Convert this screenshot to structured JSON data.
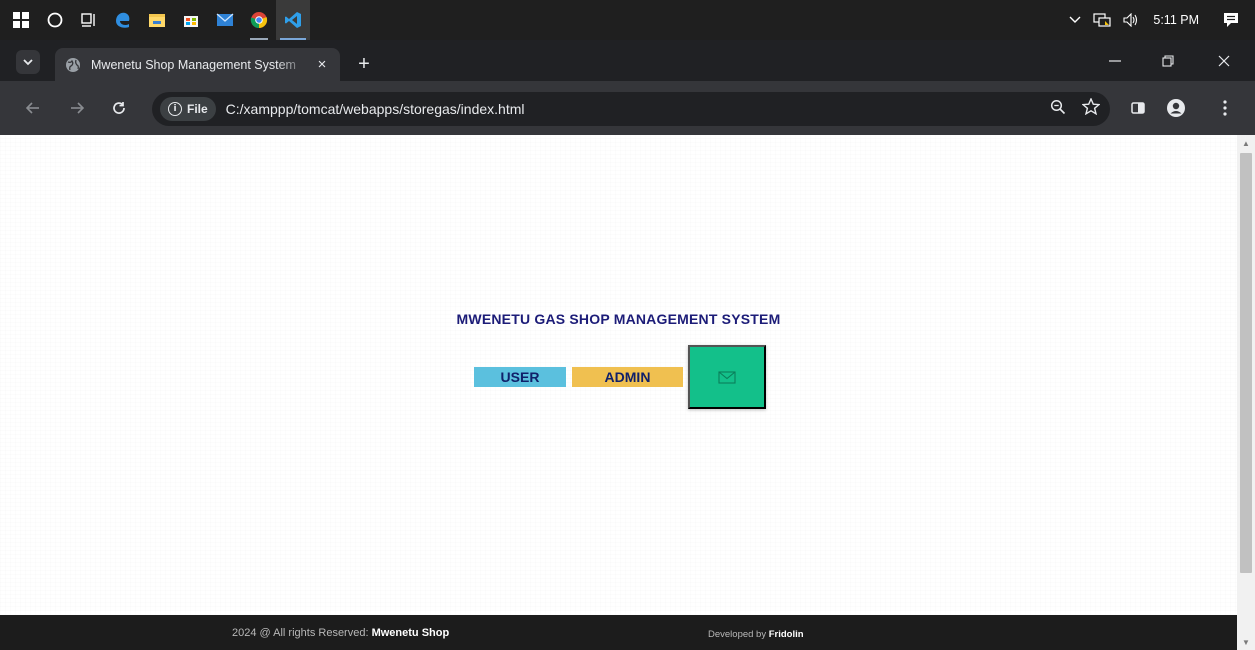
{
  "taskbar": {
    "icons": [
      "windows-start-icon",
      "cortana-search-icon",
      "task-view-icon",
      "edge-icon",
      "file-explorer-icon",
      "store-icon",
      "mail-icon",
      "chrome-icon",
      "vscode-icon"
    ],
    "tray": {
      "time": "5:11 PM"
    }
  },
  "browser": {
    "tab_title": "Mwenetu Shop Management System",
    "tab_close": "×",
    "new_tab": "+",
    "site_info_chip": "File",
    "url": "C:/xamppp/tomcat/webapps/storegas/index.html"
  },
  "page": {
    "title": "MWENETU GAS SHOP MANAGEMENT SYSTEM",
    "user_button": "USER",
    "admin_button": "ADMIN"
  },
  "footer": {
    "left_prefix": "2024 @ All rights Reserved: ",
    "left_brand": "Mwenetu Shop",
    "right_prefix": "Developed by ",
    "right_name": "Fridolin"
  },
  "colors": {
    "user_button_bg": "#5bc0de",
    "admin_button_bg": "#f0c050",
    "mail_button_bg": "#13c08a",
    "title_text": "#1c1c78",
    "footer_bg": "#1c1c1c"
  }
}
